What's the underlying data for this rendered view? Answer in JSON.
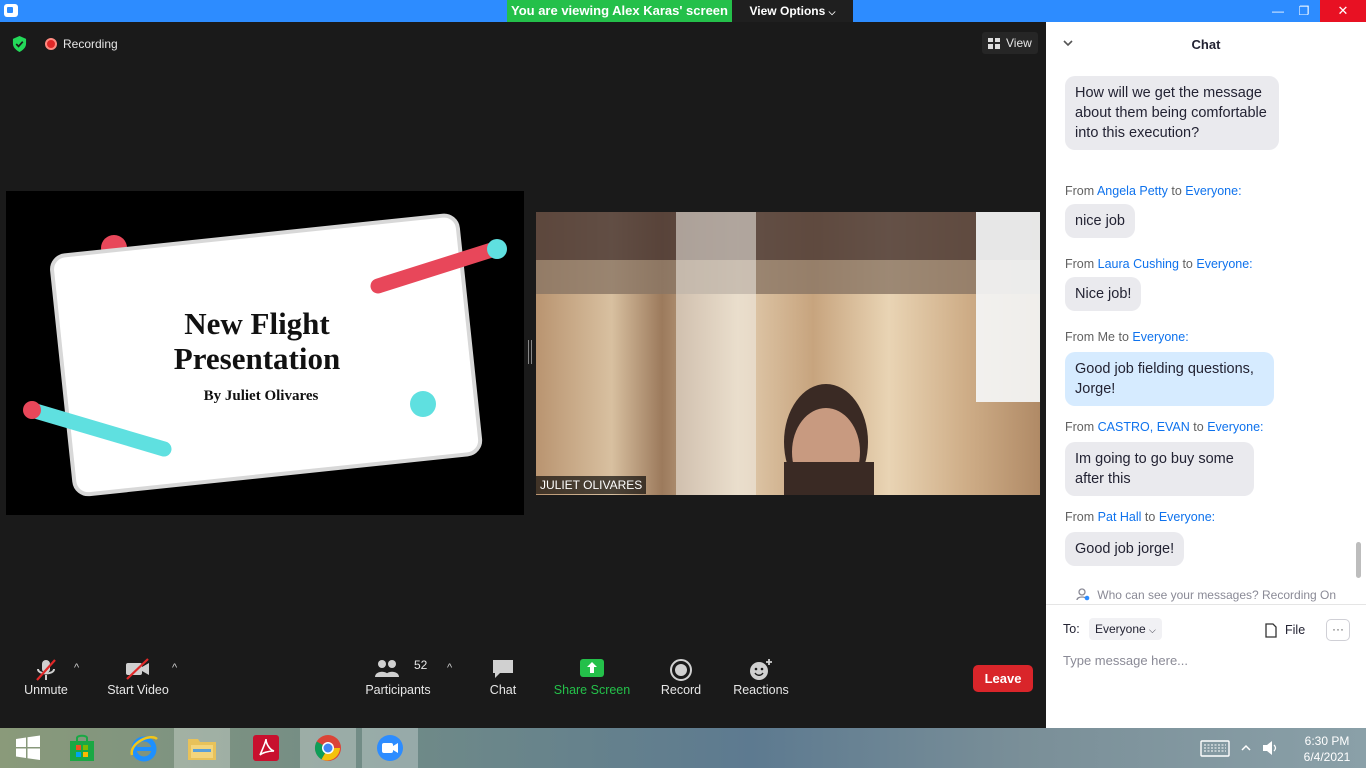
{
  "titlebar": {
    "viewing_banner": "You are viewing Alex Karas' screen",
    "view_options": "View Options",
    "minimize": "—",
    "restore": "❐",
    "close": "✕"
  },
  "status": {
    "recording": "Recording",
    "view": "View"
  },
  "shared_slide": {
    "title_line1": "New Flight",
    "title_line2": "Presentation",
    "byline": "By Juliet Olivares"
  },
  "video": {
    "participant_name": "JULIET OLIVARES"
  },
  "toolbar": {
    "unmute": "Unmute",
    "start_video": "Start Video",
    "participants": "Participants",
    "participants_count": "52",
    "chat": "Chat",
    "share_screen": "Share Screen",
    "record": "Record",
    "reactions": "Reactions",
    "leave": "Leave",
    "caret": "^"
  },
  "chat": {
    "title": "Chat",
    "messages": [
      {
        "text": "How will we get the message about them being comfortable into this execution?"
      },
      {
        "from_prefix": "From",
        "sender": "Angela Petty",
        "to_prefix": "to",
        "recipient": "Everyone:",
        "text": "nice job"
      },
      {
        "from_prefix": "From",
        "sender": "Laura Cushing",
        "to_prefix": "to",
        "recipient": "Everyone:",
        "text": "Nice job!"
      },
      {
        "from_prefix": "From Me",
        "sender": "",
        "to_prefix": "to",
        "recipient": "Everyone:",
        "text": "Good job fielding questions, Jorge!"
      },
      {
        "from_prefix": "From",
        "sender": "CASTRO, EVAN",
        "to_prefix": "to",
        "recipient": "Everyone:",
        "text": "Im going to go buy some after this"
      },
      {
        "from_prefix": "From",
        "sender": "Pat Hall",
        "to_prefix": "to",
        "recipient": "Everyone:",
        "text": "Good job jorge!"
      }
    ],
    "privacy_notice": "Who can see your messages? Recording On",
    "to_label": "To:",
    "to_value": "Everyone",
    "file_label": "File",
    "more": "···",
    "input_placeholder": "Type message here..."
  },
  "taskbar": {
    "time": "6:30 PM",
    "date": "6/4/2021"
  },
  "colors": {
    "zoom_blue": "#2d8cff",
    "banner_green": "#24c04a",
    "share_green": "#24c04a",
    "leave_red": "#d9252a",
    "link_blue": "#0e72ed",
    "slide_red": "#e8475a",
    "slide_cyan": "#5fe0e0"
  }
}
